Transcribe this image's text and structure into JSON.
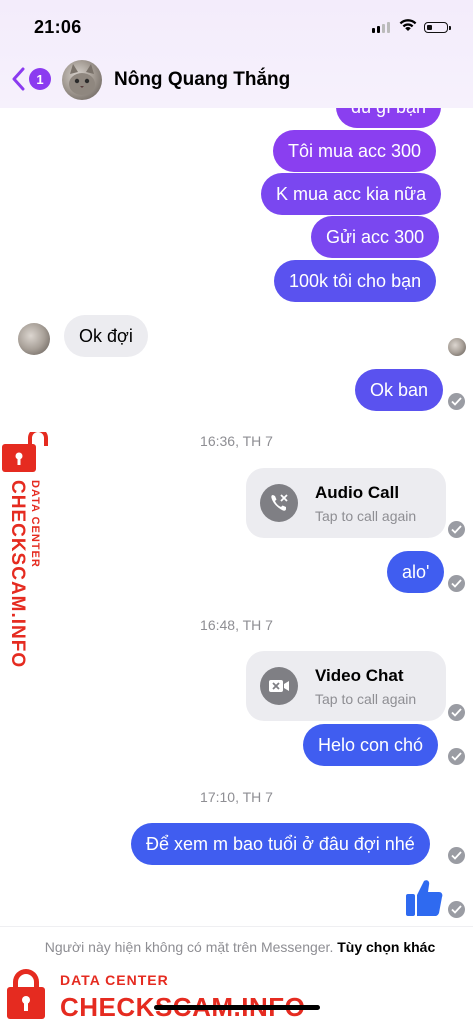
{
  "status_bar": {
    "time": "21:06"
  },
  "header": {
    "back_badge": "1",
    "contact_name": "Nông Quang Thắng"
  },
  "messages": {
    "m0": "dù gì bạn",
    "m1": "Tôi mua acc 300",
    "m2": "K mua acc kia nữa",
    "m3": "Gửi acc 300",
    "m4": "100k tôi cho bạn",
    "m5": "Ok đợi",
    "m6": "Ok ban",
    "m7": "alo'",
    "m8": "Helo con chó",
    "m9": "Để xem m bao tuổi ở đâu đợi nhé"
  },
  "timestamps": {
    "t1": "16:36, TH 7",
    "t2": "16:48, TH 7",
    "t3": "17:10, TH 7"
  },
  "calls": {
    "audio": {
      "title": "Audio Call",
      "subtitle": "Tap to call again"
    },
    "video": {
      "title": "Video Chat",
      "subtitle": "Tap to call again"
    }
  },
  "footer": {
    "status_text": "Người này hiện không có mặt trên Messenger.",
    "link_text": "Tùy chọn khác"
  },
  "watermark": {
    "side_line1": "DATA CENTER",
    "side_line2": "CHECKSCAM.INFO",
    "bottom_line1": "DATA CENTER",
    "bottom_line2": "CHECKSCAM.INFO"
  },
  "colors": {
    "header_bg": "#f3ecfb",
    "bubble_purple": "#8a3ff0",
    "bubble_blue": "#405df0",
    "incoming_bg": "#ececf0",
    "watermark_red": "#e52b20"
  }
}
